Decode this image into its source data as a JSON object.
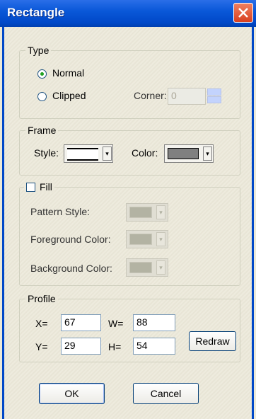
{
  "window": {
    "title": "Rectangle"
  },
  "type_group": {
    "legend": "Type",
    "normal_label": "Normal",
    "clipped_label": "Clipped",
    "selected": "Normal",
    "corner_label": "Corner:",
    "corner_value": "0"
  },
  "frame_group": {
    "legend": "Frame",
    "style_label": "Style:",
    "color_label": "Color:",
    "color": "#808080"
  },
  "fill_group": {
    "legend": "Fill",
    "checked": false,
    "pattern_label": "Pattern Style:",
    "foreground_label": "Foreground Color:",
    "background_label": "Background Color:"
  },
  "profile_group": {
    "legend": "Profile",
    "x_label": "X=",
    "x_value": "67",
    "y_label": "Y=",
    "y_value": "29",
    "w_label": "W=",
    "w_value": "88",
    "h_label": "H=",
    "h_value": "54",
    "redraw_label": "Redraw"
  },
  "buttons": {
    "ok": "OK",
    "cancel": "Cancel"
  },
  "colors": {
    "title_bar": "#0a58d8",
    "close_button": "#e05030",
    "frame_color": "#808080"
  }
}
